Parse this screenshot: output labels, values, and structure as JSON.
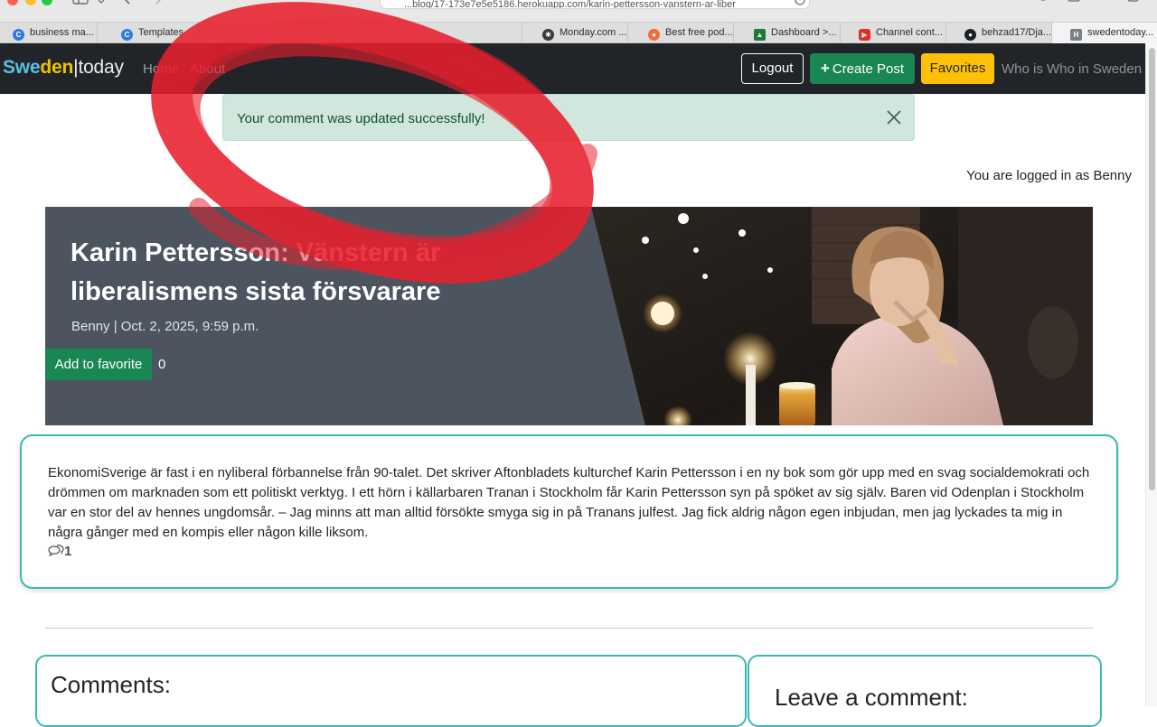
{
  "browser": {
    "url": "...blog/17-173e7e5e5186.herokuapp.com/karin-pettersson-vanstern-ar-liber",
    "tabs": [
      {
        "label": "business ma...",
        "icon": "circle-c-icon"
      },
      {
        "label": "Templates",
        "icon": "circle-c-icon"
      },
      {
        "label": "Monday.com ...l",
        "icon": "openai-icon"
      },
      {
        "label": "Best free pod...",
        "icon": "podcast-icon"
      },
      {
        "label": "Dashboard >...",
        "icon": "dashboard-icon"
      },
      {
        "label": "Channel cont...",
        "icon": "youtube-icon"
      },
      {
        "label": "behzad17/Dja...",
        "icon": "github-icon"
      },
      {
        "label": "swedentoday...",
        "icon": "h-icon"
      }
    ]
  },
  "navbar": {
    "brand_swe": "Swe",
    "brand_den": "den",
    "brand_bar": "|",
    "brand_today": "today",
    "home": "Home",
    "about": "About",
    "logout": "Logout",
    "create_post": "Create Post",
    "favorites": "Favorites",
    "who_is_who": "Who is Who in Sweden"
  },
  "alert": {
    "message": "Your comment was updated successfully!"
  },
  "logged_in": "You are logged in as Benny",
  "post": {
    "title_line1": "Karin Pettersson: Vänstern är",
    "title_line2": "liberalismens sista försvarare",
    "meta": "Benny | Oct. 2, 2025, 9:59 p.m.",
    "add_favorite": "Add to favorite",
    "favorite_count": "0",
    "content": "EkonomiSverige är fast i en nyliberal förbannelse från 90-talet. Det skriver Aftonbladets kulturchef Karin Pettersson i en ny bok som gör upp med en svag socialdemokrati och drömmen om marknaden som ett politiskt verktyg. I ett hörn i källarbaren Tranan i Stockholm får Karin Pettersson syn på spöket av sig själv. Baren vid Odenplan i Stockholm var en stor del av hennes ungdomsår. – Jag minns att man alltid försökte smyga sig in på Tranans julfest. Jag fick aldrig någon egen inbjudan, men jag lyckades ta mig in några gånger med en kompis eller någon kille liksom.",
    "comment_count": "1"
  },
  "comments": {
    "title": "Comments:"
  },
  "leave_comment": {
    "title": "Leave a comment:"
  },
  "colors": {
    "navbar_bg": "#212529",
    "success_green": "#198754",
    "warning_yellow": "#ffc107",
    "alert_bg": "#d1e7dd",
    "card_border_teal": "#3bb9b2",
    "annotation_red": "#e8202e"
  }
}
